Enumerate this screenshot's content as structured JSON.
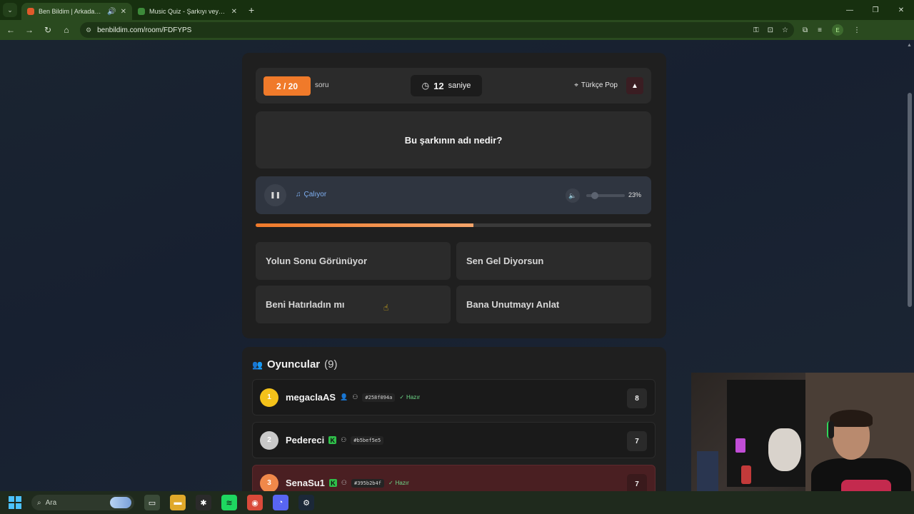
{
  "browser": {
    "tabs": [
      {
        "title": "Ben Bildim | Arkadaşlarınla",
        "active": true
      },
      {
        "title": "Music Quiz - Şarkıyı veya sanat",
        "active": false
      }
    ],
    "url": "benbildim.com/room/FDFYPS",
    "avatar_letter": "E"
  },
  "quiz": {
    "counter": "2 / 20",
    "counter_word": "soru",
    "timer_value": "12",
    "timer_unit": "saniye",
    "category": "Türkçe Pop",
    "question": "Bu şarkının adı nedir?",
    "status": "Çalıyor",
    "volume_label": "23%",
    "volume_level": 0.23,
    "progress": 0.55,
    "options": [
      "Yolun Sonu Görünüyor",
      "Sen Gel Diyorsun",
      "Beni Hatırladın mı",
      "Bana Unutmayı Anlat"
    ]
  },
  "players": {
    "title": "Oyuncular",
    "count": "(9)",
    "list": [
      {
        "rank": "1",
        "name": "megaclaAS",
        "id": "#258f094a",
        "ready": "Hazır",
        "score": "8"
      },
      {
        "rank": "2",
        "name": "Pedereci",
        "id": "#b5bef5e5",
        "ready": "",
        "score": "7"
      },
      {
        "rank": "3",
        "name": "SenaSu1",
        "id": "#395b2b4f",
        "ready": "Hazır",
        "score": "7"
      }
    ]
  },
  "taskbar": {
    "search_placeholder": "Ara"
  },
  "colors": {
    "accent": "#f07a2a",
    "rank1": "#f4c21a",
    "rank2": "#c9c9c9",
    "rank3": "#f0884a",
    "ready": "#6fda8a"
  }
}
